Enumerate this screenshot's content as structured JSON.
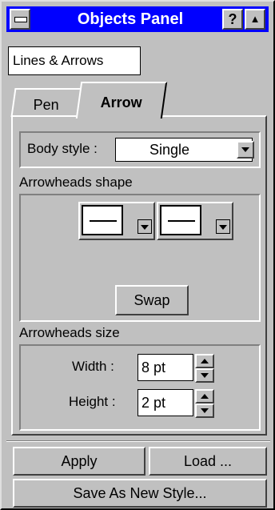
{
  "window": {
    "title": "Objects Panel",
    "help_label": "?",
    "rollup_label": "▲"
  },
  "dropdown": {
    "value": "Lines & Arrows"
  },
  "tabs": [
    {
      "label": "Pen"
    },
    {
      "label": "Arrow",
      "active": true
    }
  ],
  "body_style": {
    "label": "Body style :",
    "value": "Single"
  },
  "arrowheads_shape": {
    "label": "Arrowheads shape",
    "swap_label": "Swap"
  },
  "arrowheads_size": {
    "label": "Arrowheads size",
    "width": {
      "label": "Width :",
      "value": "8 pt"
    },
    "height": {
      "label": "Height :",
      "value": "2 pt"
    }
  },
  "footer": {
    "apply_label": "Apply",
    "load_label": "Load ...",
    "save_label": "Save As New Style..."
  }
}
